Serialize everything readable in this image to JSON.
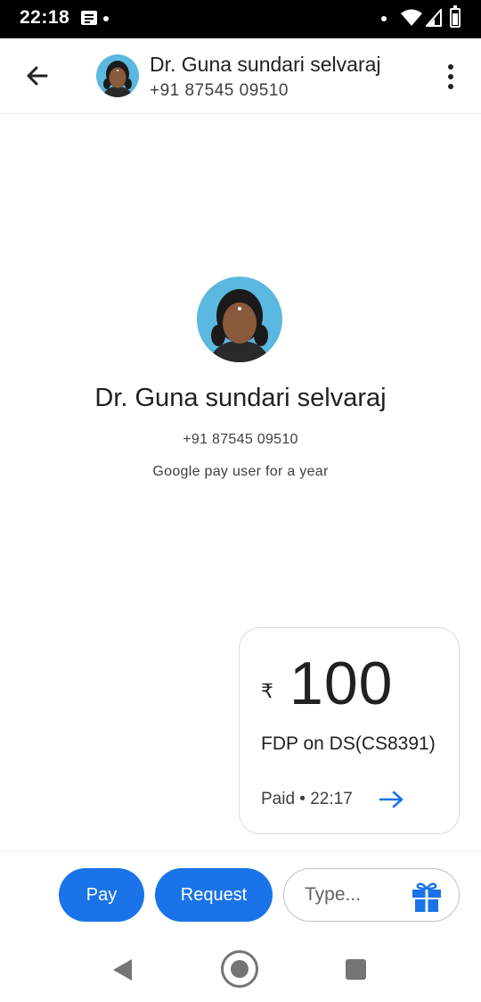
{
  "status_bar": {
    "time": "22:18",
    "icons": [
      "notification-icon",
      "dot-icon",
      "wifi-icon",
      "signal-icon",
      "battery-icon"
    ]
  },
  "header": {
    "back_icon": "arrow-back-icon",
    "contact_name": "Dr. Guna sundari selvaraj",
    "contact_phone": "+91 87545 09510",
    "more_icon": "more-vert-icon"
  },
  "profile": {
    "name": "Dr. Guna sundari selvaraj",
    "phone": "+91 87545 09510",
    "status": "Google pay user for a year"
  },
  "transaction": {
    "currency_symbol": "₹",
    "amount": "100",
    "note": "FDP on DS(CS8391)",
    "status": "Paid • 22:17",
    "arrow_icon": "arrow-forward-icon"
  },
  "actions": {
    "pay_label": "Pay",
    "request_label": "Request",
    "message_placeholder": "Type...",
    "gift_icon": "gift-icon"
  },
  "nav_bar": {
    "icons": [
      "nav-back-icon",
      "nav-home-icon",
      "nav-recents-icon"
    ]
  },
  "colors": {
    "accent": "#1a73e8",
    "status_bar_bg": "#000000",
    "avatar_bg": "#5bb8e0"
  }
}
